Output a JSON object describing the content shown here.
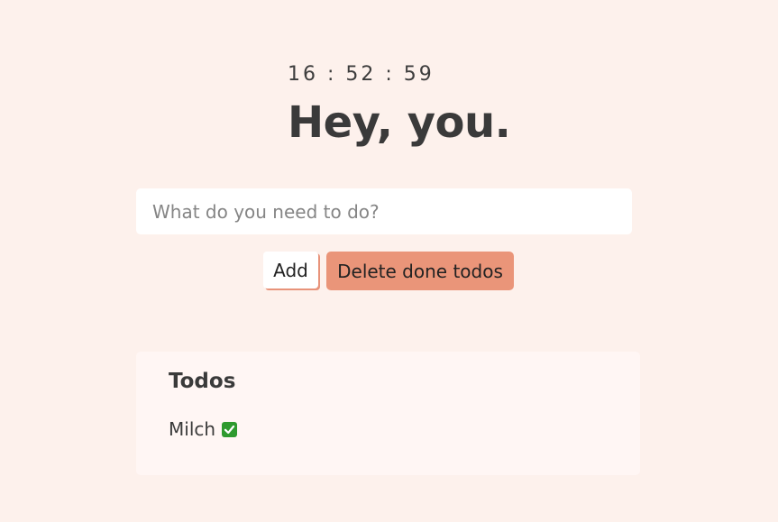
{
  "clock": {
    "time": "16 : 52 : 59"
  },
  "greeting": {
    "text": "Hey, you."
  },
  "todo_form": {
    "input_value": "",
    "placeholder": "What do you need to do?",
    "add_label": "Add",
    "delete_done_label": "Delete done todos"
  },
  "todos": {
    "heading": "Todos",
    "items": [
      {
        "label": "Milch",
        "done": true,
        "status_icon": "check-mark-icon"
      }
    ]
  },
  "colors": {
    "background": "#fdf1ec",
    "accent": "#ea9579",
    "done_check": "#2e9a2e"
  }
}
